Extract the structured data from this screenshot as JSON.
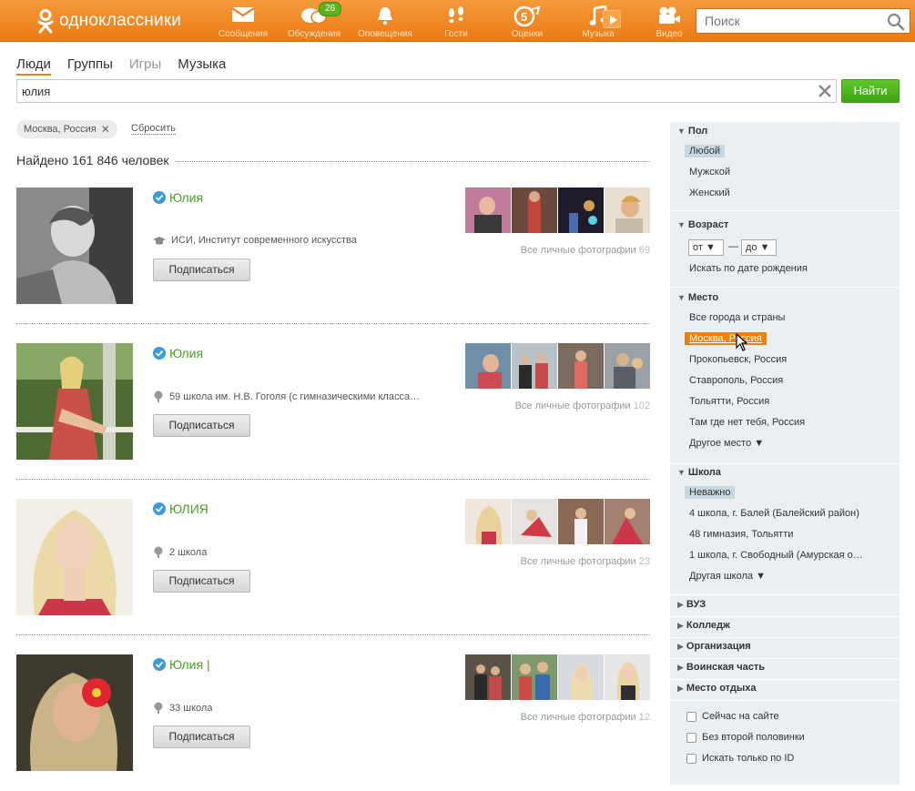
{
  "logo": {
    "text": "одноклассники"
  },
  "nav": [
    {
      "label": "Сообщения",
      "icon": "envelope-icon"
    },
    {
      "label": "Обсуждения",
      "icon": "chat-icon",
      "badge": "26"
    },
    {
      "label": "Оповещения",
      "icon": "bell-icon"
    },
    {
      "label": "Гости",
      "icon": "footprints-icon"
    },
    {
      "label": "Оценки",
      "icon": "rating-icon"
    },
    {
      "label": "Музыка",
      "icon": "music-icon"
    },
    {
      "label": "Видео",
      "icon": "video-camera-icon"
    }
  ],
  "top_search": {
    "placeholder": "Поиск"
  },
  "tabs": [
    "Люди",
    "Группы",
    "Игры",
    "Музыка"
  ],
  "query": {
    "value": "юлия",
    "button": "Найти"
  },
  "filter_chip": "Москва, Россия",
  "reset_label": "Сбросить",
  "found_text": "Найдено 161 846 человек",
  "results": [
    {
      "name": "Юлия",
      "info": "ИСИ, Институт современного искусства",
      "info_icon": "graduation-cap-icon",
      "subscribe": "Подписаться",
      "photos_label": "Все личные фотографии",
      "photos_count": "69"
    },
    {
      "name": "Юлия",
      "info": "59 школа им. Н.В. Гоголя (с гимназическими класса…",
      "info_icon": "school-bell-icon",
      "subscribe": "Подписаться",
      "photos_label": "Все личные фотографии",
      "photos_count": "102"
    },
    {
      "name": "ЮЛИЯ",
      "info": "2 школа",
      "info_icon": "school-bell-icon",
      "subscribe": "Подписаться",
      "photos_label": "Все личные фотографии",
      "photos_count": "23"
    },
    {
      "name": "Юлия |",
      "info": "33 школа",
      "info_icon": "school-bell-icon",
      "subscribe": "Подписаться",
      "photos_label": "Все личные фотографии",
      "photos_count": "12"
    }
  ],
  "sidebar": {
    "gender": {
      "title": "Пол",
      "options": [
        "Любой",
        "Мужской",
        "Женский"
      ]
    },
    "age": {
      "title": "Возраст",
      "from": "от",
      "to": "до",
      "dash": "—",
      "birthdate_link": "Искать по дате рождения"
    },
    "place": {
      "title": "Место",
      "options": [
        "Все города и страны",
        "Москва, Россия",
        "Прокопьевск, Россия",
        "Ставрополь, Россия",
        "Тольятти, Россия",
        "Там где нет тебя, Россия"
      ],
      "other": "Другое место"
    },
    "school": {
      "title": "Школа",
      "options": [
        "Неважно",
        "4 школа, г. Балей (Балейский район)",
        "48 гимназия, Тольятти",
        "1 школа, г. Свободный (Амурская о…"
      ],
      "other": "Другая школа"
    },
    "collapsed": [
      "ВУЗ",
      "Колледж",
      "Организация",
      "Воинская часть",
      "Место отдыха"
    ],
    "checks": [
      "Сейчас на сайте",
      "Без второй половинки",
      "Искать только по ID"
    ]
  },
  "colors": {
    "brand_orange": "#ee8208",
    "green": "#4c9d2a",
    "sidebar_bg": "#eceff2"
  }
}
